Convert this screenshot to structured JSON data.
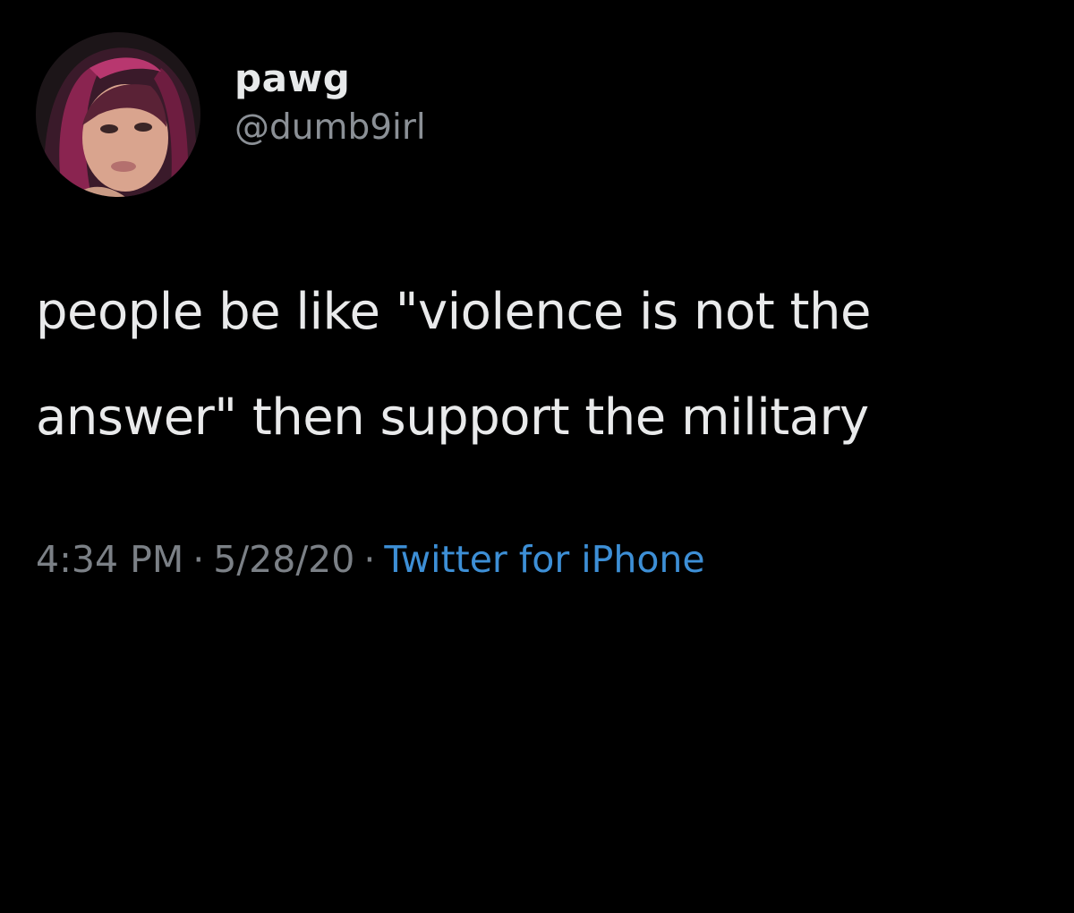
{
  "tweet": {
    "author": {
      "display_name": "pawg",
      "handle": "@dumb9irl"
    },
    "text_lines": [
      "people be like \"violence is not the",
      "answer\" then support the military"
    ],
    "meta": {
      "time": "4:34 PM",
      "separator": "·",
      "date": "5/28/20",
      "source": "Twitter for iPhone"
    }
  },
  "colors": {
    "background": "#000000",
    "text": "#e7e9ea",
    "secondary": "#7b8086",
    "link": "#3d8fd6"
  }
}
